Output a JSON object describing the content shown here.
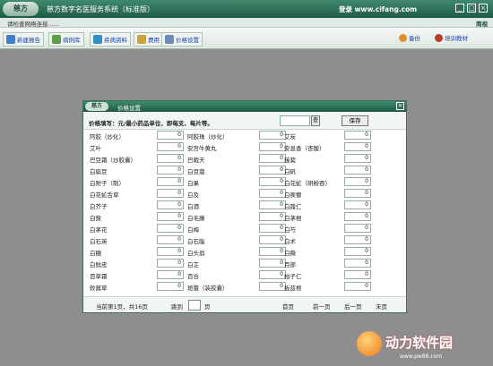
{
  "titlebar": {
    "logo": "慈方",
    "title": "慈方数字名医服务系统（标准版）",
    "login_site": "登录 www.cifang.com",
    "btn_minimize": "_",
    "btn_maximize": "□",
    "btn_close": "×"
  },
  "statusbar": {
    "text": "请检查网络连接......",
    "collapse": "简视"
  },
  "toolbar": {
    "items": [
      "新建报告",
      "病例库",
      "疾病资料",
      "费用",
      "价格设置"
    ],
    "right_items": [
      "备份",
      "培训教材"
    ]
  },
  "dialog": {
    "logo": "慈方",
    "title": "价格设置",
    "price_label": "价格填写：元/最小药品单位，即每支、每片等。",
    "confirm_label": "查",
    "save_label": "保存",
    "herbs": [
      [
        "阿胶（炒化）",
        "0",
        "阿胶珠（炒化）",
        "0",
        "艾炭",
        "0"
      ],
      [
        "艾叶",
        "0",
        "安宫牛黄丸",
        "0",
        "安息香（杏酸）",
        "0"
      ],
      [
        "巴豆霜（炒胶囊）",
        "0",
        "巴戟天",
        "0",
        "菝葜",
        "0"
      ],
      [
        "白扁豆",
        "0",
        "白豆蔻",
        "0",
        "白矾",
        "0"
      ],
      [
        "白附子（制）",
        "0",
        "白果",
        "0",
        "白花蛇（研粉吞）",
        "0"
      ],
      [
        "白花蛇舌草",
        "0",
        "白及",
        "0",
        "白蒺藜",
        "0"
      ],
      [
        "白芥子",
        "0",
        "白酒",
        "0",
        "白蔻仁",
        "0"
      ],
      [
        "白蔹",
        "0",
        "白毛藤",
        "0",
        "白茅根",
        "0"
      ],
      [
        "白茅花",
        "0",
        "白梅",
        "0",
        "白芍",
        "0"
      ],
      [
        "白石英",
        "0",
        "白石脂",
        "0",
        "白术",
        "0"
      ],
      [
        "白糖",
        "0",
        "白头翁",
        "0",
        "白薇",
        "0"
      ],
      [
        "白鲜皮",
        "0",
        "白芷",
        "0",
        "百部",
        "0"
      ],
      [
        "百草霜",
        "0",
        "百合",
        "0",
        "柏子仁",
        "0"
      ],
      [
        "败酱草",
        "0",
        "斑蝥（装胶囊）",
        "0",
        "板蓝根",
        "0"
      ]
    ],
    "footer": {
      "page_info": "当前第1页，共16页",
      "jump_label": "跳到",
      "page_suffix": "页",
      "first": "首页",
      "prev": "前一页",
      "next": "后一页",
      "last": "末页"
    }
  },
  "watermark": {
    "text": "动力软件园",
    "url": "www.pw88.com"
  }
}
